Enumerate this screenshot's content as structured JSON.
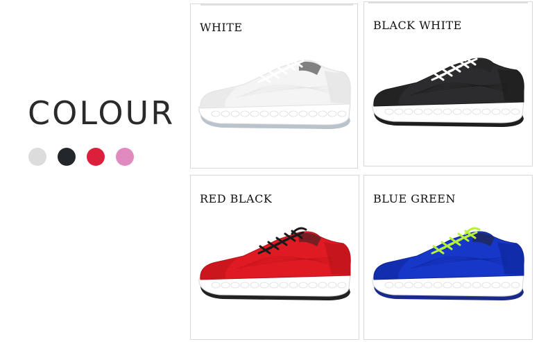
{
  "heading": "COLOUR",
  "swatches": [
    {
      "name": "white-swatch",
      "color": "#dcdcdc"
    },
    {
      "name": "black-swatch",
      "color": "#23272b"
    },
    {
      "name": "red-swatch",
      "color": "#dc1f3a"
    },
    {
      "name": "pink-swatch",
      "color": "#e08ac0"
    }
  ],
  "cards": [
    {
      "label": "WHITE",
      "upper": "#f4f4f4",
      "accent": "#e0e0e0",
      "laces": "#ffffff",
      "sole": "#ffffff",
      "outsole": "#b9c3cc"
    },
    {
      "label": "BLACK WHITE",
      "upper": "#2c2c2e",
      "accent": "#1a1a1a",
      "laces": "#ffffff",
      "sole": "#ffffff",
      "outsole": "#1e1e1e"
    },
    {
      "label": "RED BLACK",
      "upper": "#e01a22",
      "accent": "#b5121a",
      "laces": "#1a1a1a",
      "sole": "#ffffff",
      "outsole": "#222222"
    },
    {
      "label": "BLUE GREEN",
      "upper": "#1737c9",
      "accent": "#0e2596",
      "laces": "#b6f23a",
      "sole": "#ffffff",
      "outsole": "#1a2a8a"
    }
  ]
}
